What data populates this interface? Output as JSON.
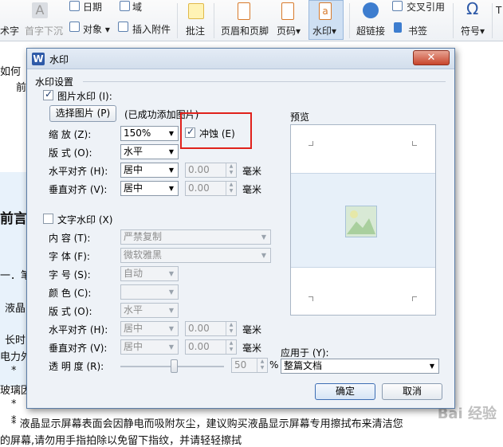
{
  "ribbon": {
    "items": [
      {
        "label": "术字",
        "grey": false
      },
      {
        "label": "首字下沉",
        "grey": true
      },
      {
        "label": "日期",
        "grey": false
      },
      {
        "label": "域",
        "grey": false
      },
      {
        "label": "对象",
        "grey": false
      },
      {
        "label": "插入附件",
        "grey": false
      },
      {
        "label": "批注",
        "grey": false
      },
      {
        "label": "页眉和页脚",
        "grey": false
      },
      {
        "label": "页码",
        "grey": false
      },
      {
        "label": "水印",
        "grey": false
      },
      {
        "label": "超链接",
        "grey": false
      },
      {
        "label": "交叉引用",
        "grey": false
      },
      {
        "label": "书签",
        "grey": false
      },
      {
        "label": "符号",
        "grey": false
      }
    ]
  },
  "document": {
    "lines": [
      "如何",
      "前",
      "前言",
      "一．笔",
      "液晶",
      "长时",
      "电力外",
      "*",
      "玻璃因",
      "*",
      "*",
      "* 液晶显示屏幕表面会因静电而吸附灰尘，建议购买液晶显示屏幕专用擦拭布来清洁您",
      "的屏幕,请勿用手指拍除以免留下指纹，并请轻轻擦拭"
    ],
    "watermark_text": "Bai 经验"
  },
  "dialog": {
    "title": "水印",
    "group_title": "水印设置",
    "picture": {
      "checkbox_label": "图片水印 (I):",
      "checked": true,
      "select_button": "选择图片 (P)",
      "status": "(已成功添加图片)",
      "scale_label": "缩    放 (Z):",
      "scale_value": "150%",
      "washout_label": "冲蚀 (E)",
      "washout_checked": true,
      "layout_label": "版    式 (O):",
      "layout_value": "水平",
      "halign_label": "水平对齐 (H):",
      "halign_value": "居中",
      "halign_offset": "0.00",
      "valign_label": "垂直对齐 (V):",
      "valign_value": "居中",
      "valign_offset": "0.00",
      "unit": "毫米"
    },
    "text": {
      "checkbox_label": "文字水印 (X)",
      "checked": false,
      "content_label": "内    容 (T):",
      "content_value": "严禁复制",
      "font_label": "字    体 (F):",
      "font_value": "微软雅黑",
      "size_label": "字    号 (S):",
      "size_value": "自动",
      "color_label": "颜    色 (C):",
      "color_value": "",
      "layout_label": "版    式 (O):",
      "layout_value": "水平",
      "halign_label": "水平对齐 (H):",
      "halign_value": "居中",
      "halign_offset": "0.00",
      "valign_label": "垂直对齐 (V):",
      "valign_value": "居中",
      "valign_offset": "0.00",
      "unit": "毫米",
      "transparency_label": "透 明 度 (R):",
      "transparency_value": "50",
      "transparency_unit": "%"
    },
    "preview_label": "预览",
    "apply_label": "应用于 (Y):",
    "apply_value": "整篇文档",
    "ok": "确定",
    "cancel": "取消"
  },
  "colors": {
    "highlight_box": "#e0211b",
    "title_accent": "#2e5aa8"
  }
}
